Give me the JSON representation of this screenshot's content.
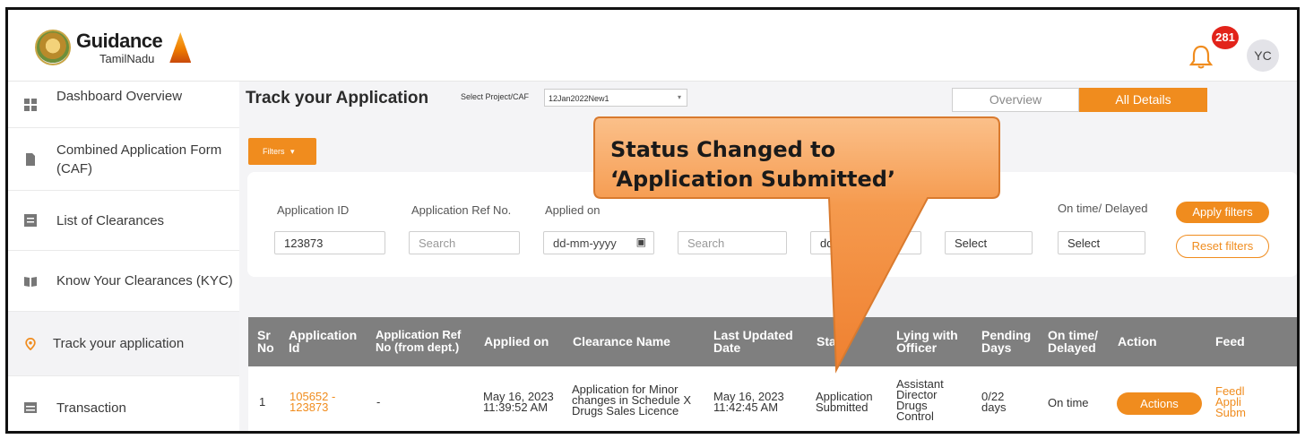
{
  "header": {
    "logo_title": "Guidance",
    "logo_subtitle": "TamilNadu",
    "notification_count": "281",
    "avatar_initials": "YC"
  },
  "sidebar": {
    "items": [
      {
        "label": "Dashboard Overview",
        "icon": "grid-icon"
      },
      {
        "label": "Combined Application Form (CAF)",
        "icon": "document-icon"
      },
      {
        "label": "List of Clearances",
        "icon": "list-icon"
      },
      {
        "label": "Know Your Clearances (KYC)",
        "icon": "book-icon"
      },
      {
        "label": "Track your application",
        "icon": "location-pin-icon"
      },
      {
        "label": "Transaction",
        "icon": "card-icon"
      }
    ]
  },
  "main": {
    "title": "Track your Application",
    "select_label": "Select Project/CAF",
    "select_value": "12Jan2022New1",
    "tabs": [
      "Overview",
      "All Details"
    ],
    "filters_button": "Filters"
  },
  "filters": {
    "application_id_label": "Application ID",
    "application_id_value": "123873",
    "ref_no_label": "Application Ref No.",
    "ref_no_placeholder": "Search",
    "applied_on_label": "Applied on",
    "applied_on_placeholder": "dd-mm-yyyy",
    "search_placeholder": "Search",
    "date2_placeholder": "dd-",
    "status_placeholder": "Select",
    "ontime_label": "On time/ Delayed",
    "ontime_placeholder": "Select",
    "apply_button": "Apply filters",
    "reset_button": "Reset filters"
  },
  "table": {
    "headers": [
      "Sr No",
      "Application Id",
      "Application Ref No (from dept.)",
      "Applied on",
      "Clearance Name",
      "Last Updated Date",
      "Stat",
      "Lying with Officer",
      "Pending Days",
      "On time/ Delayed",
      "Action",
      "Feed"
    ],
    "row": {
      "sr": "1",
      "application_id": "105652 - 123873",
      "ref_no": "-",
      "applied_on": "May 16, 2023 11:39:52 AM",
      "clearance_name": "Application for Minor changes in Schedule X Drugs Sales Licence",
      "last_updated": "May 16, 2023 11:42:45 AM",
      "status": "Application Submitted",
      "lying_with": "Assistant Director Drugs Control",
      "pending_days": "0/22 days",
      "ontime": "On time",
      "action_button": "Actions",
      "feedback": "Feedl Appli Subm"
    }
  },
  "callout": {
    "line1": "Status Changed to",
    "line2": "‘Application Submitted’"
  },
  "colors": {
    "accent": "#f08c1e",
    "table_header": "#7f7f7f",
    "notification": "#e2231a"
  }
}
